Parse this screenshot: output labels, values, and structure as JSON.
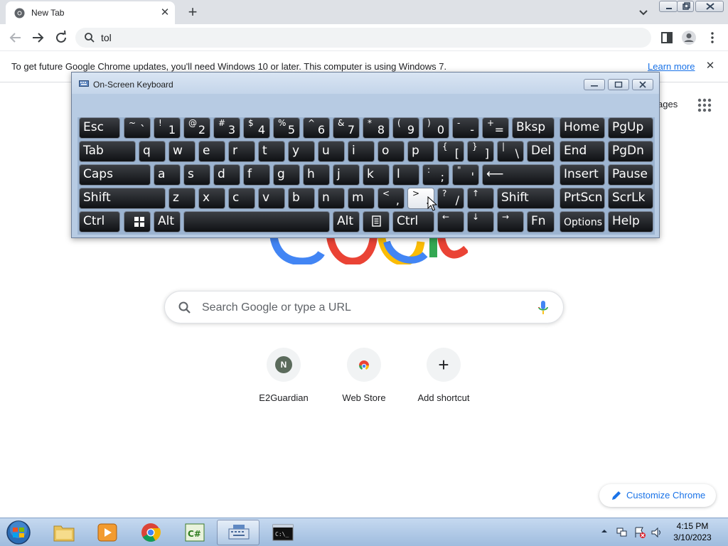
{
  "browser": {
    "tab_title": "New Tab",
    "tab_close": "✕",
    "new_tab": "+",
    "omnibox_text": "tol"
  },
  "infobar": {
    "message": "To get future Google Chrome updates, you'll need Windows 10 or later. This computer is using Windows 7.",
    "link": "Learn more",
    "close": "✕"
  },
  "ntp": {
    "images_link_partial": "ages",
    "search_placeholder": "Search Google or type a URL",
    "shortcuts": [
      {
        "label": "E2Guardian",
        "avatar_letter": "N"
      },
      {
        "label": "Web Store"
      },
      {
        "label": "Add shortcut",
        "icon": "+"
      }
    ],
    "customize_label": "Customize Chrome"
  },
  "osk": {
    "title": "On-Screen Keyboard",
    "rows": [
      [
        {
          "main": "Esc"
        },
        {
          "top": "~",
          "bot": "`"
        },
        {
          "top": "!",
          "bot": "1"
        },
        {
          "top": "@",
          "bot": "2"
        },
        {
          "top": "#",
          "bot": "3"
        },
        {
          "top": "$",
          "bot": "4"
        },
        {
          "top": "%",
          "bot": "5"
        },
        {
          "top": "^",
          "bot": "6"
        },
        {
          "top": "&",
          "bot": "7"
        },
        {
          "top": "*",
          "bot": "8"
        },
        {
          "top": "(",
          "bot": "9"
        },
        {
          "top": ")",
          "bot": "0"
        },
        {
          "top": "-",
          "bot": "-"
        },
        {
          "top": "+",
          "bot": "="
        },
        {
          "main": "Bksp"
        },
        {
          "main": "Home"
        },
        {
          "main": "PgUp"
        }
      ],
      [
        {
          "main": "Tab"
        },
        {
          "main": "q"
        },
        {
          "main": "w"
        },
        {
          "main": "e"
        },
        {
          "main": "r"
        },
        {
          "main": "t"
        },
        {
          "main": "y"
        },
        {
          "main": "u"
        },
        {
          "main": "i"
        },
        {
          "main": "o"
        },
        {
          "main": "p"
        },
        {
          "top": "{",
          "bot": "["
        },
        {
          "top": "}",
          "bot": "]"
        },
        {
          "top": "|",
          "bot": "\\"
        },
        {
          "main": "Del"
        },
        {
          "main": "End"
        },
        {
          "main": "PgDn"
        }
      ],
      [
        {
          "main": "Caps"
        },
        {
          "main": "a"
        },
        {
          "main": "s"
        },
        {
          "main": "d"
        },
        {
          "main": "f"
        },
        {
          "main": "g"
        },
        {
          "main": "h"
        },
        {
          "main": "j"
        },
        {
          "main": "k"
        },
        {
          "main": "l"
        },
        {
          "top": ":",
          "bot": ";"
        },
        {
          "top": "\"",
          "bot": "'"
        },
        {
          "main": "⟵"
        },
        {
          "main": "Insert"
        },
        {
          "main": "Pause"
        }
      ],
      [
        {
          "main": "Shift"
        },
        {
          "main": "z"
        },
        {
          "main": "x"
        },
        {
          "main": "c"
        },
        {
          "main": "v"
        },
        {
          "main": "b"
        },
        {
          "main": "n"
        },
        {
          "main": "m"
        },
        {
          "top": "<",
          "bot": ","
        },
        {
          "top": ">",
          "bot": ".",
          "pressed": true
        },
        {
          "top": "?",
          "bot": "/"
        },
        {
          "top": "↑"
        },
        {
          "main": "Shift"
        },
        {
          "main": "PrtScn"
        },
        {
          "main": "ScrLk"
        }
      ],
      [
        {
          "main": "Ctrl"
        },
        {
          "icon": "windows-logo-icon"
        },
        {
          "main": "Alt"
        },
        {
          "main": ""
        },
        {
          "main": "Alt"
        },
        {
          "icon": "context-menu-icon"
        },
        {
          "main": "Ctrl"
        },
        {
          "top": "←"
        },
        {
          "top": "↓"
        },
        {
          "top": "→"
        },
        {
          "main": "Fn"
        },
        {
          "main": "Options",
          "small": true
        },
        {
          "main": "Help"
        }
      ]
    ]
  },
  "taskbar": {
    "apps": [
      "windows-explorer",
      "windows-media-player",
      "google-chrome",
      "csharp-editor",
      "on-screen-keyboard",
      "command-prompt"
    ],
    "active_app": "on-screen-keyboard",
    "clock_time": "4:15 PM",
    "clock_date": "3/10/2023"
  },
  "colors": {
    "chrome_tabstrip": "#dee1e6",
    "link_blue": "#1a73e8",
    "osk_frame": "#b7cbe3",
    "key_face": "#1b1d21",
    "taskbar": "#b4cde9"
  }
}
